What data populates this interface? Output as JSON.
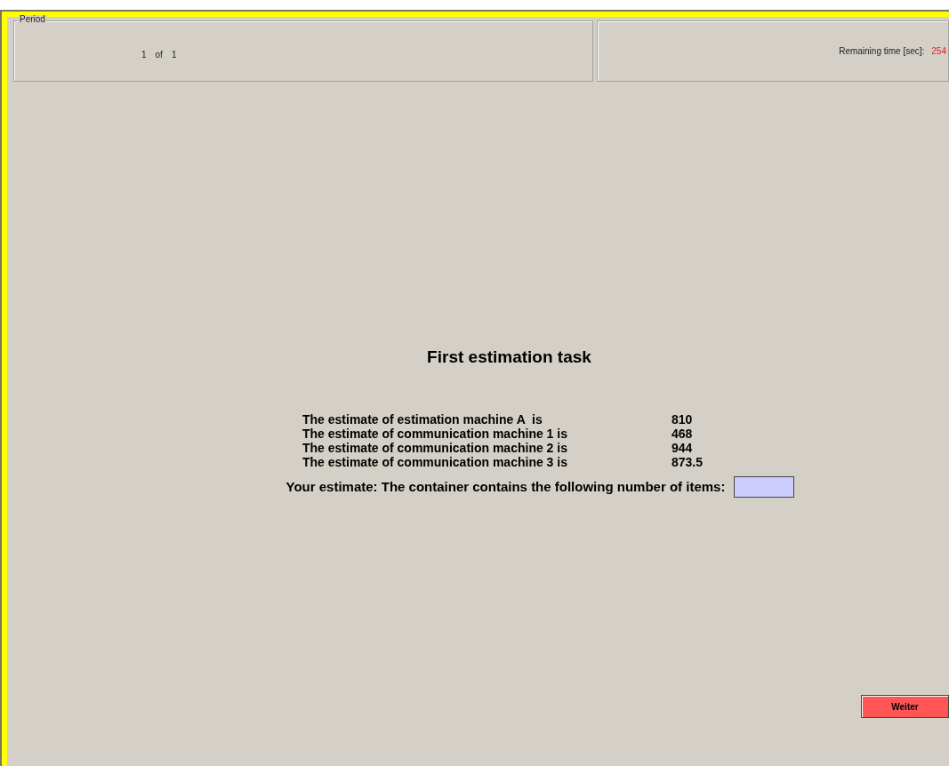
{
  "period": {
    "legend": "Period",
    "current": "1",
    "of": "of",
    "total": "1"
  },
  "timer": {
    "label": "Remaining time [sec]:",
    "value": "254"
  },
  "task": {
    "title": "First estimation task",
    "estimates": [
      {
        "label": "The estimate of estimation machine A  is",
        "value": "810"
      },
      {
        "label": "The estimate of communication machine 1 is",
        "value": "468"
      },
      {
        "label": "The estimate of communication machine 2 is",
        "value": "944"
      },
      {
        "label": "The estimate of communication machine 3 is",
        "value": "873.5"
      }
    ],
    "prompt": "Your estimate: The container contains the following number of items:"
  },
  "button": "Weiter"
}
